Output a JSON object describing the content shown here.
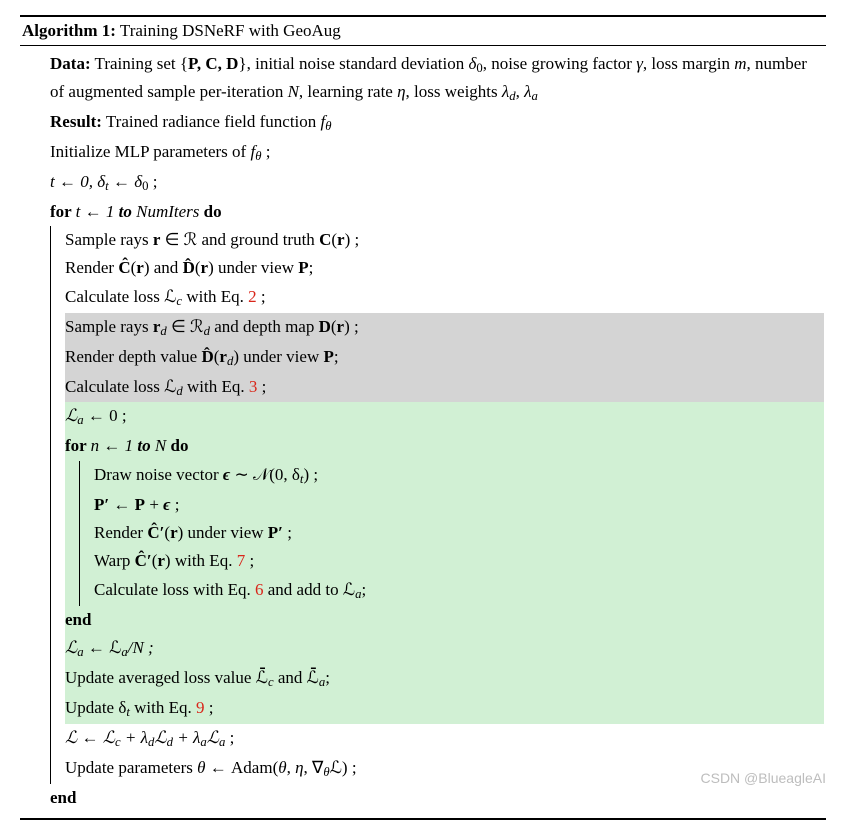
{
  "title_prefix": "Algorithm 1:",
  "title_rest": " Training DSNeRF with GeoAug",
  "data_label": "Data:",
  "data_text_1": " Training set {",
  "data_PCD": "P, C, D",
  "data_text_2": "}, initial noise standard deviation ",
  "delta0": "δ",
  "delta0_sub": "0",
  "data_text_3": ", noise growing factor ",
  "gamma": "γ",
  "data_text_4": ", loss margin ",
  "m": "m",
  "data_text_5": ", number of augmented sample per-iteration ",
  "N": "N",
  "data_text_6": ", learning rate ",
  "eta": "η",
  "data_text_7": ", loss weights ",
  "lambda_d": "λ",
  "lambda_d_sub": "d",
  "lambda_a": "λ",
  "lambda_a_sub": "a",
  "result_label": "Result:",
  "result_text": " Trained radiance field function ",
  "f_theta": "f",
  "f_theta_sub": "θ",
  "line_init": "Initialize MLP parameters of ",
  "semi": " ;",
  "line_t0": "t ← 0, δ",
  "line_t0_sub": "t",
  "line_t0_b": " ← δ",
  "line_t0_sub2": "0",
  "for1a": "for ",
  "for1b": "t ← 1",
  "for1c": " to ",
  "for1d": "NumIters",
  "do": " do",
  "l_sample1a": "Sample rays ",
  "l_sample1_r": "r",
  "l_sample1b": " ∈ ℛ and ground truth ",
  "l_sample1_C": "C",
  "l_sample1c": "(",
  "l_sample1d": ") ;",
  "l_render1a": "Render ",
  "l_render1_Chat": "Ĉ",
  "l_render1b": "(",
  "l_render1c": ") and ",
  "l_render1_Dhat": "D̂",
  "l_render1d": "(",
  "l_render1e": ") under view ",
  "l_render1_P": "P",
  "l_render1f": ";",
  "l_calc1a": "Calculate loss ℒ",
  "l_calc1_sub": "c",
  "l_calc1b": " with Eq. ",
  "eq2": "2",
  "l_calc1c": " ;",
  "l_sample2a": "Sample rays ",
  "l_sample2_rd": "r",
  "l_sample2_rdsub": "d",
  "l_sample2b": " ∈ ℛ",
  "l_sample2_bsub": "d",
  "l_sample2c": " and depth map ",
  "l_sample2_D": "D",
  "l_sample2d": "(",
  "l_sample2e": ") ;",
  "l_render2a": "Render depth value ",
  "l_render2b": "(",
  "l_render2c": ") under view ",
  "l_render2d": ";",
  "l_calc2a": "Calculate loss ℒ",
  "l_calc2_sub": "d",
  "l_calc2b": " with Eq. ",
  "eq3": "3",
  "l_calc2c": " ;",
  "l_La0": "ℒ",
  "l_La0_sub": "a",
  "l_La0b": " ← 0 ;",
  "for2a": "for ",
  "for2b": "n ← 1",
  "for2c": " to ",
  "for2d": "N",
  "l_draw_a": "Draw noise vector ",
  "eps": "ϵ",
  "l_draw_b": " ∼ 𝒩(0, δ",
  "l_draw_sub": "t",
  "l_draw_c": ") ;",
  "l_Pprime_a": "P′",
  "l_Pprime_b": " ← ",
  "l_Pprime_c": "P",
  "l_Pprime_d": " + ",
  "l_Pprime_e": " ;",
  "l_renderC_a": "Render ",
  "l_renderC_Chat": "Ĉ′",
  "l_renderC_b": "(",
  "l_renderC_c": ") under view ",
  "l_renderC_d": " ;",
  "l_warp_a": "Warp ",
  "l_warp_b": "(",
  "l_warp_c": ") with Eq. ",
  "eq7": "7",
  "l_warp_d": " ;",
  "l_calc3a": "Calculate loss with Eq. ",
  "eq6": "6",
  "l_calc3b": " and add to ℒ",
  "l_calc3_sub": "a",
  "l_calc3c": ";",
  "end": "end",
  "l_LaN_a": "ℒ",
  "l_LaN_sub": "a",
  "l_LaN_b": " ← ℒ",
  "l_LaN_sub2": "a",
  "l_LaN_c": "/N ;",
  "l_upavg_a": "Update averaged loss value ℒ̄",
  "l_upavg_sub1": "c",
  "l_upavg_b": " and ℒ̄",
  "l_upavg_sub2": "a",
  "l_upavg_c": ";",
  "l_upd_a": "Update δ",
  "l_upd_sub": "t",
  "l_upd_b": " with Eq. ",
  "eq9": "9",
  "l_upd_c": " ;",
  "l_L_a": "ℒ ← ℒ",
  "l_L_sub1": "c",
  "l_L_b": " + λ",
  "l_L_sub2": "d",
  "l_L_c": "ℒ",
  "l_L_sub3": "d",
  "l_L_d": " + λ",
  "l_L_sub4": "a",
  "l_L_e": "ℒ",
  "l_L_sub5": "a",
  "l_L_f": " ;",
  "l_param_a": "Update parameters ",
  "theta": "θ",
  "l_param_b": " ← Adam(",
  "l_param_c": ", ",
  "l_param_d": ", ∇",
  "l_param_nabla_sub": "θ",
  "l_param_e": "ℒ) ;",
  "watermark": "CSDN @BlueagleAI"
}
